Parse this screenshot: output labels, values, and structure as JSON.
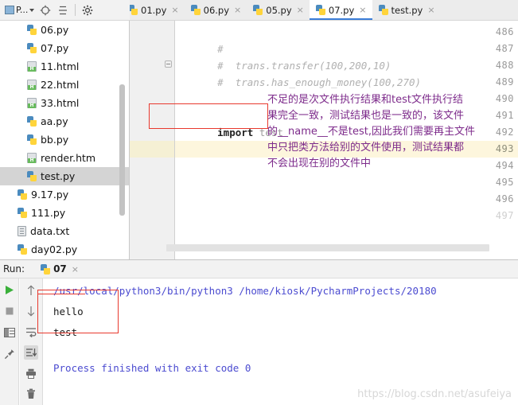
{
  "toolbar": {
    "project_label": "P...",
    "icons": [
      {
        "name": "project-dropdown",
        "glyph": "project"
      },
      {
        "name": "locate-target-icon",
        "glyph": "target"
      },
      {
        "name": "collapse-all-icon",
        "glyph": "collapse"
      },
      {
        "name": "settings-gear-icon",
        "glyph": "gear"
      }
    ]
  },
  "tabs": [
    {
      "label": "01.py",
      "icon": "python-file-icon",
      "active": false
    },
    {
      "label": "06.py",
      "icon": "python-file-icon",
      "active": false
    },
    {
      "label": "05.py",
      "icon": "python-file-icon",
      "active": false
    },
    {
      "label": "07.py",
      "icon": "python-file-icon",
      "active": true
    },
    {
      "label": "test.py",
      "icon": "python-file-icon",
      "active": false
    }
  ],
  "close_glyph": "×",
  "tree": {
    "items": [
      {
        "label": "06.py",
        "type": "py",
        "indent": true,
        "selected": false
      },
      {
        "label": "07.py",
        "type": "py",
        "indent": true,
        "selected": false
      },
      {
        "label": "11.html",
        "type": "html",
        "indent": true,
        "selected": false
      },
      {
        "label": "22.html",
        "type": "html",
        "indent": true,
        "selected": false
      },
      {
        "label": "33.html",
        "type": "html",
        "indent": true,
        "selected": false
      },
      {
        "label": "aa.py",
        "type": "py",
        "indent": true,
        "selected": false
      },
      {
        "label": "bb.py",
        "type": "py",
        "indent": true,
        "selected": false
      },
      {
        "label": "render.htm",
        "type": "html",
        "indent": true,
        "selected": false
      },
      {
        "label": "test.py",
        "type": "py",
        "indent": true,
        "selected": true
      },
      {
        "label": "9.17.py",
        "type": "py",
        "indent": false,
        "selected": false
      },
      {
        "label": "111.py",
        "type": "py",
        "indent": false,
        "selected": false
      },
      {
        "label": "data.txt",
        "type": "txt",
        "indent": false,
        "selected": false
      },
      {
        "label": "day02.py",
        "type": "py",
        "indent": false,
        "selected": false
      }
    ]
  },
  "editor": {
    "line_numbers": [
      "486",
      "487",
      "488",
      "489",
      "490",
      "491",
      "492",
      "493",
      "494",
      "495",
      "496",
      "497"
    ],
    "current_line": "493",
    "lines": [
      {
        "num": "486",
        "comment": "#",
        "code": ""
      },
      {
        "num": "487",
        "comment": "#  trans.transfer(100,200,10)",
        "code": ""
      },
      {
        "num": "488",
        "comment": "#  trans.has_enough_money(100,270)",
        "code": ""
      },
      {
        "num": "489",
        "comment": "",
        "code": ""
      },
      {
        "num": "490",
        "comment": "",
        "code": "import test",
        "keyword": "import",
        "identifier": " test"
      }
    ],
    "annotation_lines": [
      "不足的是次文件执行结果和test文件执行结",
      "果完全一致，测试结果也是一致的，该文件",
      "的__name__不是test,因此我们需要再主文件",
      "中只把类方法给别的文件使用，测试结果都",
      "不会出现在别的文件中"
    ],
    "annotation_color": "#7d2b8b",
    "highlight_box_color": "#e8392e"
  },
  "run_panel": {
    "title": "Run:",
    "tab_label": "07",
    "console_lines": [
      {
        "text": "/usr/local/python3/bin/python3 /home/kiosk/PycharmProjects/20180",
        "style": "path"
      },
      {
        "text": "hello",
        "style": "out"
      },
      {
        "text": "test",
        "style": "out"
      },
      {
        "text": "",
        "style": "out"
      },
      {
        "text": "Process finished with exit code 0",
        "style": "done"
      }
    ],
    "left_icons": [
      {
        "name": "run-button-icon",
        "glyph": "play"
      },
      {
        "name": "stop-button-icon",
        "glyph": "stop"
      },
      {
        "name": "restore-layout-icon",
        "glyph": "layout"
      },
      {
        "name": "pin-tab-icon",
        "glyph": "pin"
      }
    ],
    "side_icons": [
      {
        "name": "scroll-up-icon",
        "glyph": "arrow-up"
      },
      {
        "name": "scroll-down-icon",
        "glyph": "arrow-down"
      },
      {
        "name": "soft-wrap-icon",
        "glyph": "wrap"
      },
      {
        "name": "scroll-to-end-icon",
        "glyph": "scroll-end",
        "selected": true
      },
      {
        "name": "print-icon",
        "glyph": "print"
      },
      {
        "name": "clear-all-icon",
        "glyph": "trash"
      }
    ]
  },
  "watermark": "https://blog.csdn.net/asufeiya"
}
